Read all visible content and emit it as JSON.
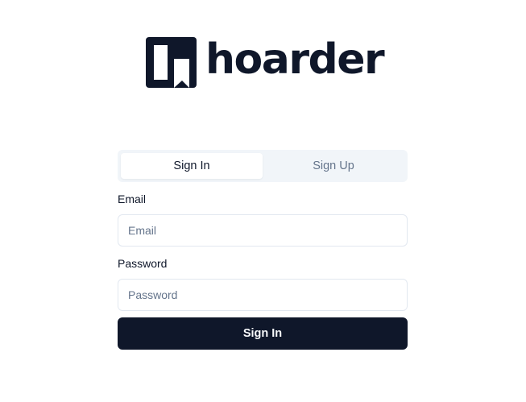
{
  "brand": {
    "name": "hoarder",
    "color": "#0f172a"
  },
  "auth_tabs": {
    "sign_in": "Sign In",
    "sign_up": "Sign Up",
    "active": "sign_in"
  },
  "form": {
    "email_label": "Email",
    "email_placeholder": "Email",
    "email_value": "",
    "password_label": "Password",
    "password_placeholder": "Password",
    "password_value": "",
    "submit_label": "Sign In"
  },
  "colors": {
    "primary": "#0f172a",
    "tab_bg": "#f1f5f9",
    "muted_text": "#64748b",
    "border": "#e2e8f0"
  }
}
